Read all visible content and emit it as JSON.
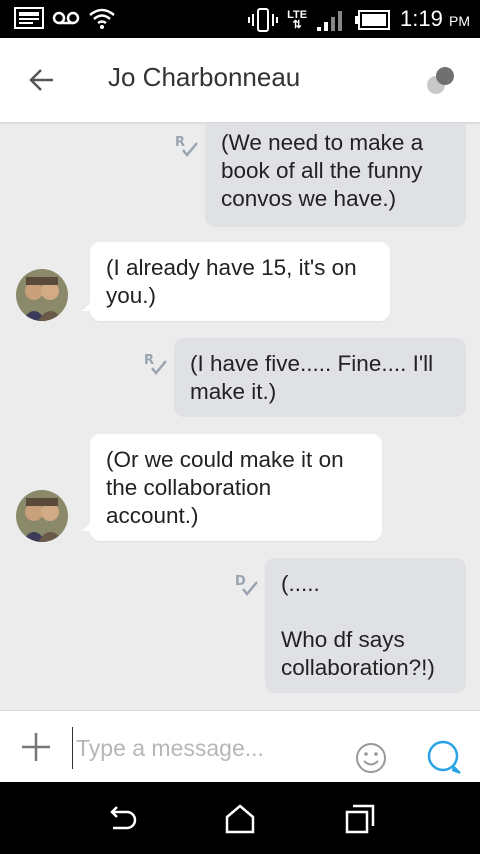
{
  "status_bar": {
    "time": "1:19",
    "ampm": "PM",
    "network": "LTE",
    "icons": [
      "image-icon",
      "voicemail-icon",
      "wifi-icon",
      "vibrate-icon",
      "lte-data-icon",
      "signal-icon",
      "battery-icon"
    ]
  },
  "app_bar": {
    "title": "Jo Charbonneau",
    "back_icon": "arrow-left-icon",
    "presence_icon": "presence-dots-icon"
  },
  "messages": [
    {
      "direction": "outgoing",
      "status": "R",
      "lines": [
        "(We need to make a",
        "book of all the funny",
        "convos we have.)"
      ]
    },
    {
      "direction": "incoming",
      "lines": [
        "(I already have 15, it's on",
        "you.)"
      ]
    },
    {
      "direction": "outgoing",
      "status": "R",
      "lines": [
        "(I have five..... Fine.... I'll",
        "make it.)"
      ]
    },
    {
      "direction": "incoming",
      "lines": [
        "(Or we could make it on",
        "the collaboration",
        "account.)"
      ]
    },
    {
      "direction": "outgoing",
      "status": "D",
      "lines": [
        "(.....",
        "",
        "Who df says",
        "collaboration?!)"
      ]
    }
  ],
  "compose": {
    "placeholder": "Type a message...",
    "value": ""
  },
  "nav_bar": {
    "icons": [
      "back-icon",
      "home-icon",
      "recents-icon"
    ]
  },
  "colors": {
    "outgoing_bubble": "#dfe1e5",
    "incoming_bubble": "#ffffff",
    "accent": "#29a3e6",
    "background": "#ececec"
  }
}
